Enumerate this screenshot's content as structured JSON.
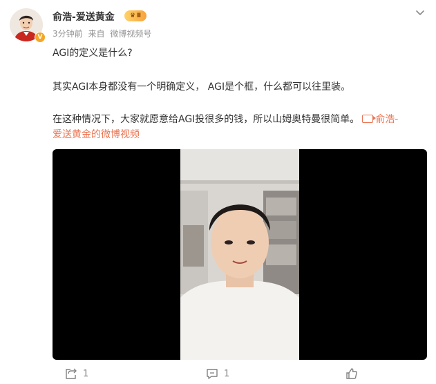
{
  "post": {
    "author": {
      "name": "俞浩-爱送黄金",
      "vip_level": "Ⅱ",
      "avatar_icon": "avatar",
      "verified": true
    },
    "meta": {
      "time": "3分钟前",
      "source_prefix": "来自",
      "source": "微博视频号"
    },
    "paragraphs": [
      "AGI的定义是什么?",
      "其实AGI本身都没有一个明确定义， AGI是个框，什么都可以往里装。",
      "在这种情况下，大家就愿意给AGI投很多的钱，所以山姆奥特曼很简单。"
    ],
    "video_link": {
      "label_line1": "俞浩-",
      "label_line2": "爱送黄金的微博视频",
      "icon": "video-link-icon"
    },
    "video": {
      "state": "paused"
    },
    "actions": [
      {
        "name": "repost",
        "icon": "share-icon",
        "count": "1"
      },
      {
        "name": "comment",
        "icon": "comment-icon",
        "count": "1"
      },
      {
        "name": "like",
        "icon": "thumbs-up-icon",
        "count": ""
      }
    ]
  },
  "colors": {
    "accent": "#eb7350",
    "text": "#333333",
    "meta": "#939393",
    "vip": "#f7a23a"
  }
}
